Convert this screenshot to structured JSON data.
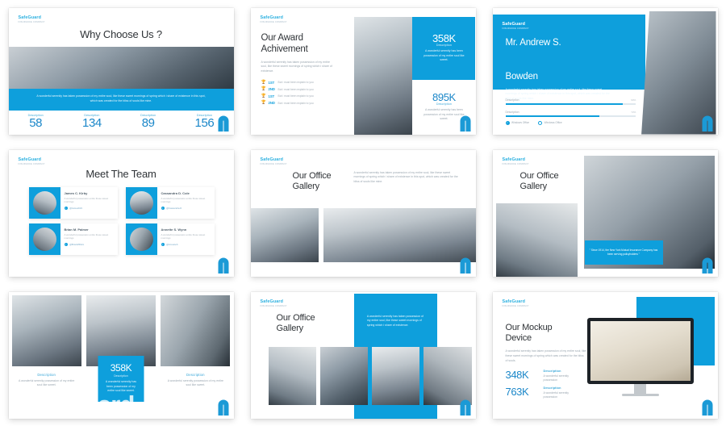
{
  "brand": {
    "name": "SafeGuard",
    "tagline": "INSURANCE COMPANY",
    "accent": "#0e9fdc",
    "accent_dark": "#1b87c9",
    "text_dark": "#2f3337",
    "text_muted": "#9aa6b0"
  },
  "watermark": "SafeGuard",
  "lorem": {
    "short": "A wonderful serenity has taken possession of my entire soul, like these sweet mornings of spring.",
    "medium": "A wonderful serenity has taken possession of my entire soul, like these sweet mornings of spring which i share of existence.",
    "long": "A wonderful serenity has taken possession of my entire soul, like these sweet mornings of spring which i share of existence in this spot, which was created for the bliss of souls like mine.",
    "tiny": "A wonderful serenity has taken possession of my entire soul, like sweet."
  },
  "slides": [
    {
      "id": "why-choose-us",
      "title": "Why Choose Us ?",
      "body": "A wonderful serenity has taken possession of my entire soul, like these sweet mornings of spring which i share of existence in this spot, which was created for the bliss of souls like mine.",
      "stats": [
        {
          "label": "Description",
          "value": "58"
        },
        {
          "label": "Description",
          "value": "134"
        },
        {
          "label": "Description",
          "value": "89"
        },
        {
          "label": "Description",
          "value": "156"
        }
      ]
    },
    {
      "id": "our-award-achivement",
      "title_line1": "Our Award",
      "title_line2": "Achivement",
      "body": "A wonderful serenity has taken possession of my entire soul, like these sweet mornings of spring which i share of existence.",
      "awards": [
        {
          "icon": "trophy-icon",
          "rank": "1ST",
          "text": "But i must been explain to you"
        },
        {
          "icon": "trophy-icon",
          "rank": "2ND",
          "text": "But i must been explain to you"
        },
        {
          "icon": "trophy-icon",
          "rank": "1ST",
          "text": "But i must been explain to you"
        },
        {
          "icon": "trophy-icon",
          "rank": "2ND",
          "text": "But i must been explain to you"
        }
      ],
      "stat_top": {
        "value": "358K",
        "label": "Description",
        "body": "A wonderful serenity has been possession of my entire soul like sweet."
      },
      "stat_bottom": {
        "value": "895K",
        "label": "Description",
        "body": "A wonderful serenity has been possession of my entire soul like sweet."
      }
    },
    {
      "id": "mr-andrew-s-bowden",
      "title_line1": "Mr. Andrew S.",
      "title_line2": "Bowden",
      "body": "A wonderful serenity has taken possession of my entire soul, like these sweet mornings of spring which i share of existence in this spot, which was created for the bliss of souls like mine.",
      "bars": [
        {
          "label": "Description",
          "percent": "90%",
          "value": 90
        },
        {
          "label": "Description",
          "percent": "72%",
          "value": 72
        }
      ],
      "legend": [
        {
          "icon": "check-circle-icon",
          "label": "Windows Office"
        },
        {
          "icon": "circle-outline-icon",
          "label": "Windows Office"
        }
      ]
    },
    {
      "id": "meet-the-team",
      "title": "Meet The Team",
      "members": [
        {
          "name": "James C. Kirby",
          "role": "A wonderful possession entire these sweet mornings",
          "handle": "@JamesKirb",
          "social_icon": "twitter-icon"
        },
        {
          "name": "Cassandra D. Cole",
          "role": "A wonderful possession entire these sweet mornings",
          "handle": "@Cassandra.D",
          "social_icon": "twitter-icon"
        },
        {
          "name": "Brian M. Palmer",
          "role": "A wonderful possession entire these sweet mornings",
          "handle": "@BrianMPalm",
          "social_icon": "twitter-icon"
        },
        {
          "name": "Annette S. Wynn",
          "role": "A wonderful possession entire these sweet mornings",
          "handle": "@AnnetteS",
          "social_icon": "twitter-icon"
        }
      ]
    },
    {
      "id": "our-office-gallery-1",
      "title_line1": "Our Office",
      "title_line2": "Gallery",
      "body": "A wonderful serenity has taken possession of my entire soul, like these sweet mornings of spring which i share of existence in this spot, which was created for the bliss of souls like mine."
    },
    {
      "id": "our-office-gallery-2",
      "title_line1": "Our Office",
      "title_line2": "Gallery",
      "quote": "\" Since 1914, the New York Mutual Insurance Company has been serving policyholders \""
    },
    {
      "id": "gallery-stats",
      "left_caption": {
        "label": "Description",
        "body": "A wonderful serenity possession of my entire soul like sweet."
      },
      "right_caption": {
        "label": "Description",
        "body": "A wonderful serenity possession of my entire soul like sweet."
      },
      "badge": {
        "value": "358K",
        "label": "Description",
        "body": "A wonderful serenity has been possession of my entire soul like sweet."
      }
    },
    {
      "id": "our-office-gallery-3",
      "title_line1": "Our Office",
      "title_line2": "Gallery",
      "body": "A wonderful serenity has taken possession of my entire soul, like these sweet mornings of spring which i share of existence."
    },
    {
      "id": "our-mockup-device",
      "title_line1": "Our Mockup",
      "title_line2": "Device",
      "body": "A wonderful serenity has taken possession of my entire soul, like these sweet mornings of spring which was created for the bliss of souls.",
      "stats": [
        {
          "value": "348K",
          "label": "Description",
          "body": "A wonderful serenity possession"
        },
        {
          "value": "763K",
          "label": "Description",
          "body": "A wonderful serenity possession"
        }
      ]
    }
  ]
}
